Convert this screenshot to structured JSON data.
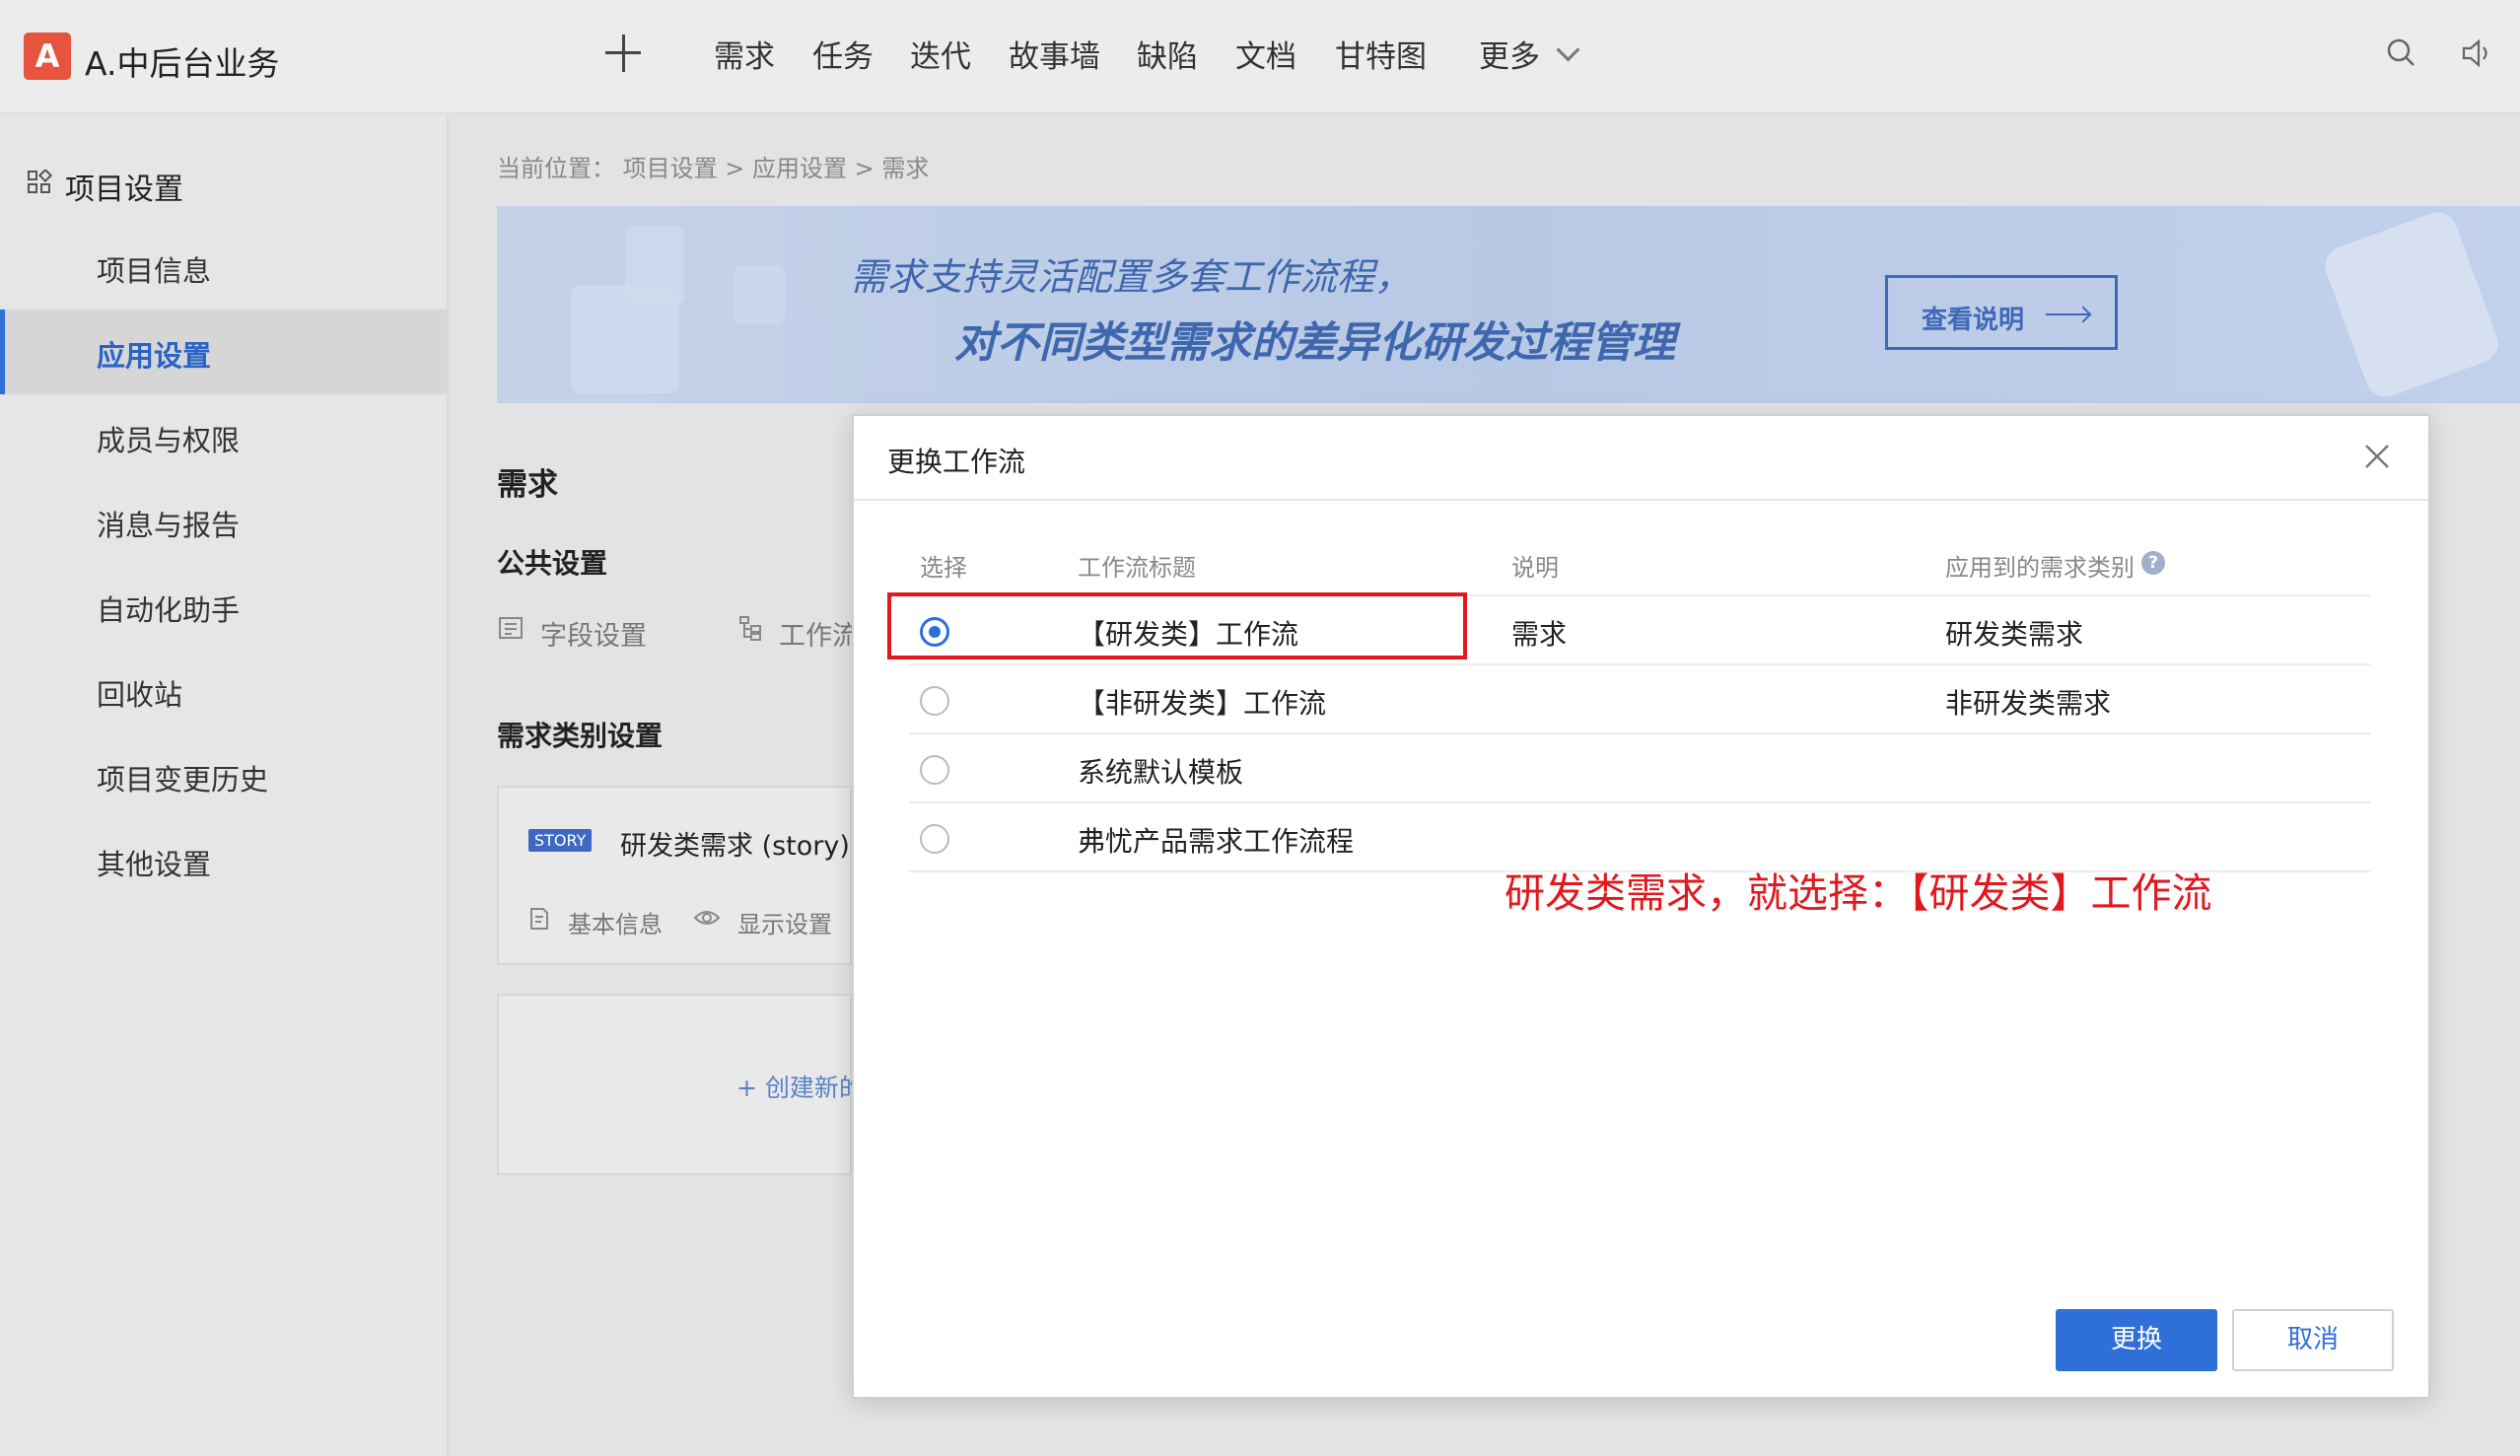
{
  "header": {
    "logo_letter": "A",
    "project_title": "A.中后台业务",
    "nav": [
      "需求",
      "任务",
      "迭代",
      "故事墙",
      "缺陷",
      "文档",
      "甘特图",
      "更多"
    ]
  },
  "sidebar": {
    "heading": "项目设置",
    "items": [
      "项目信息",
      "应用设置",
      "成员与权限",
      "消息与报告",
      "自动化助手",
      "回收站",
      "项目变更历史",
      "其他设置"
    ],
    "active_index": 1
  },
  "main": {
    "breadcrumb": "当前位置： 项目设置 > 应用设置 > 需求",
    "banner": {
      "line1": "需求支持灵活配置多套工作流程，",
      "line2": "对不同类型需求的差异化研发过程管理",
      "button": "查看说明"
    },
    "section_title": "需求",
    "public_settings": "公共设置",
    "field_settings": "字段设置",
    "workflow_settings": "工作流",
    "category_settings": "需求类别设置",
    "story_card": {
      "tag": "STORY",
      "name": "研发类需求 (story)",
      "basic_info": "基本信息",
      "display_settings": "显示设置"
    },
    "create_new": "+ 创建新的"
  },
  "modal": {
    "title": "更换工作流",
    "columns": [
      "选择",
      "工作流标题",
      "说明",
      "应用到的需求类别"
    ],
    "rows": [
      {
        "title": "【研发类】工作流",
        "desc": "需求",
        "category": "研发类需求",
        "selected": true
      },
      {
        "title": "【非研发类】工作流",
        "desc": "",
        "category": "非研发类需求",
        "selected": false
      },
      {
        "title": "系统默认模板",
        "desc": "",
        "category": "",
        "selected": false
      },
      {
        "title": "弗忧产品需求工作流程",
        "desc": "",
        "category": "",
        "selected": false
      }
    ],
    "annotation": "研发类需求，就选择：【研发类】工作流",
    "confirm_button": "更换",
    "cancel_button": "取消"
  },
  "colors": {
    "primary": "#2f6fd8",
    "logo": "#e8533d",
    "annotation_red": "#e0191f"
  }
}
